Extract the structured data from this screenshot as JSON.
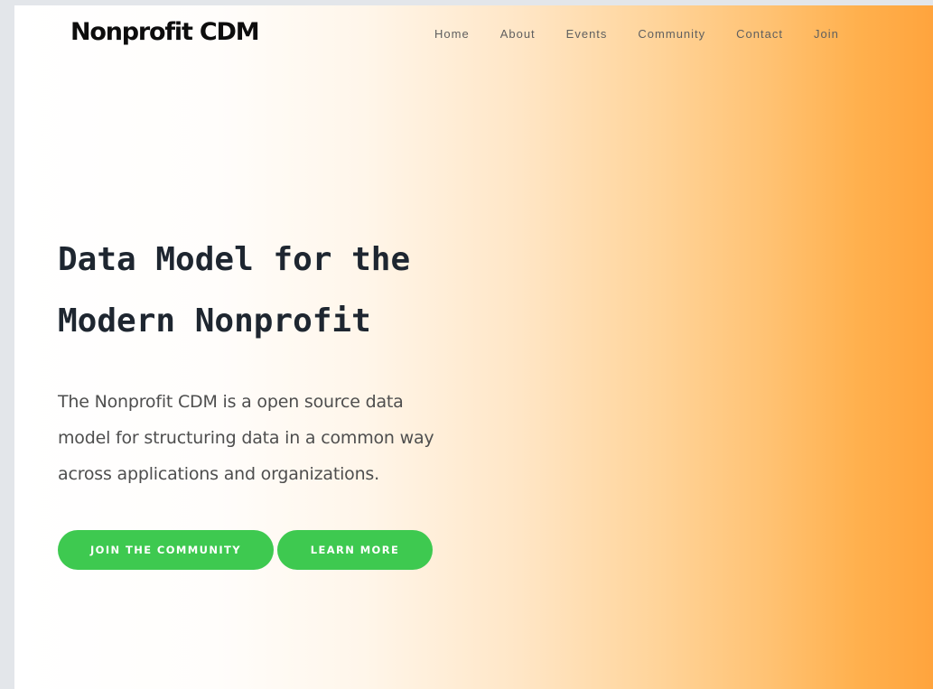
{
  "brand": {
    "logo_text": "Nonprofit CDM"
  },
  "nav": {
    "items": [
      {
        "label": "Home"
      },
      {
        "label": "About"
      },
      {
        "label": "Events"
      },
      {
        "label": "Community"
      },
      {
        "label": "Contact"
      },
      {
        "label": "Join"
      }
    ]
  },
  "hero": {
    "title_line_1": "Data Model for the",
    "title_line_2": "Modern Nonprofit",
    "text_line_1": "The Nonprofit CDM is a open source data",
    "text_line_2": "model for structuring data in a common way",
    "text_line_3": "across applications and organizations.",
    "primary_button": "JOIN THE COMMUNITY",
    "secondary_button": "LEARN MORE"
  },
  "colors": {
    "button_green": "#3ec950",
    "gradient_start": "#ffffff",
    "gradient_end": "#ffa43d",
    "title_text": "#1e2630",
    "body_text": "#4e4e4e",
    "page_backdrop": "#e3e6ea"
  }
}
